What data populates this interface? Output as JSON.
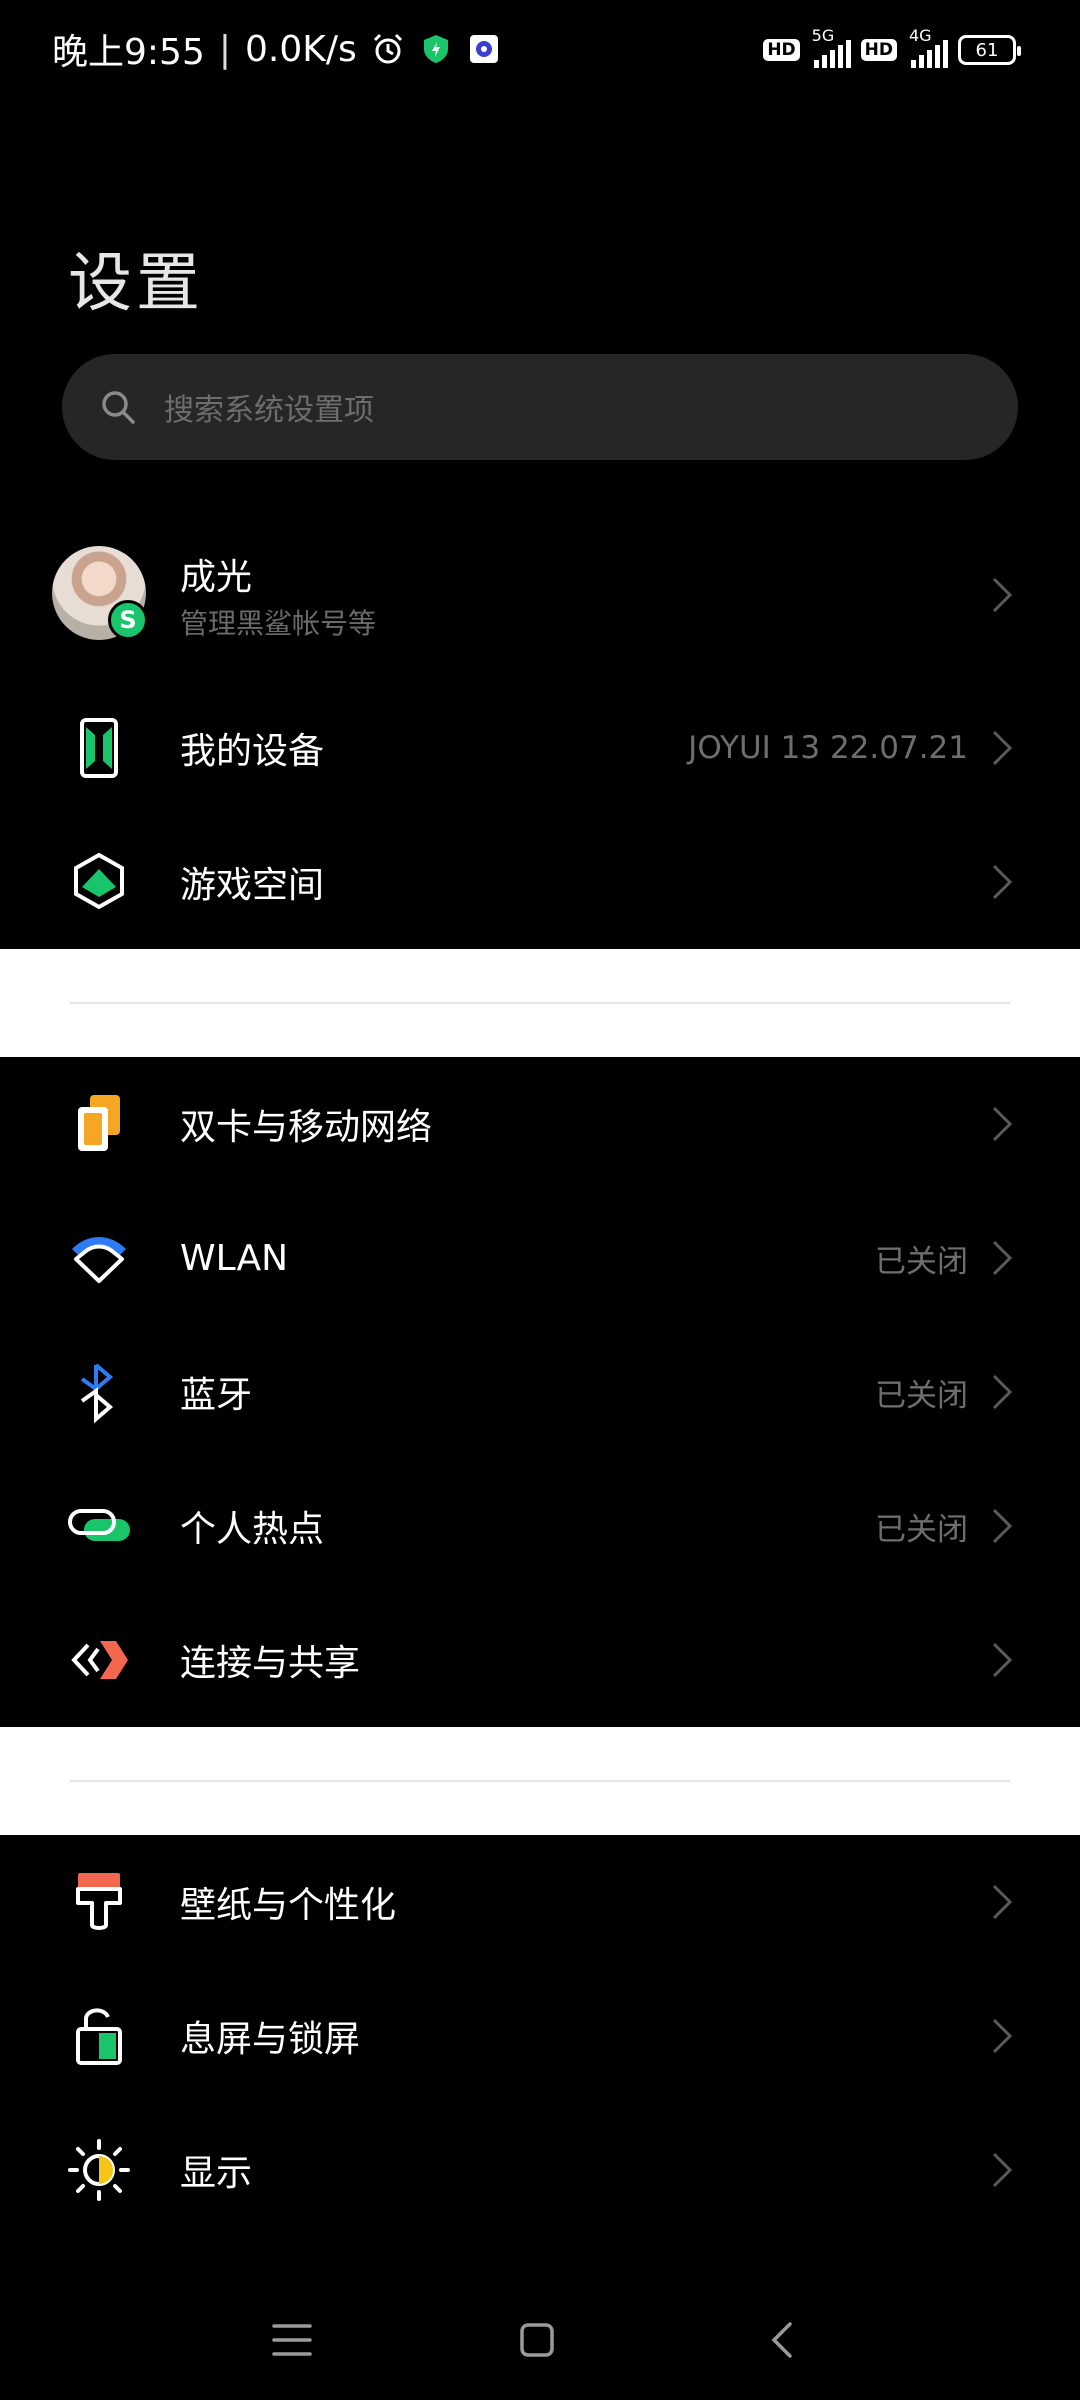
{
  "status_bar": {
    "time": "晚上9:55",
    "separator": "|",
    "speed": "0.0K/s",
    "hd1": "HD",
    "gen1": "5G",
    "hd2": "HD",
    "gen2": "4G",
    "battery": "61"
  },
  "page": {
    "title": "设置",
    "search_placeholder": "搜索系统设置项"
  },
  "account": {
    "name": "成光",
    "subtitle": "管理黑鲨帐号等",
    "badge": "S"
  },
  "items": [
    {
      "label": "我的设备",
      "value": "JOYUI 13 22.07.21",
      "icon": "device-icon"
    },
    {
      "label": "游戏空间",
      "value": "",
      "icon": "game-space-icon"
    },
    {
      "label": "双卡与移动网络",
      "value": "",
      "icon": "sim-card-icon"
    },
    {
      "label": "WLAN",
      "value": "已关闭",
      "icon": "wifi-icon"
    },
    {
      "label": "蓝牙",
      "value": "已关闭",
      "icon": "bluetooth-icon"
    },
    {
      "label": "个人热点",
      "value": "已关闭",
      "icon": "hotspot-icon"
    },
    {
      "label": "连接与共享",
      "value": "",
      "icon": "share-icon"
    },
    {
      "label": "壁纸与个性化",
      "value": "",
      "icon": "wallpaper-icon"
    },
    {
      "label": "息屏与锁屏",
      "value": "",
      "icon": "lock-screen-icon"
    },
    {
      "label": "显示",
      "value": "",
      "icon": "display-icon"
    }
  ],
  "colors": {
    "background": "#000000",
    "accent_green": "#19c46b",
    "accent_orange": "#f5a623",
    "accent_blue": "#2f7bf6",
    "accent_red": "#f2674e"
  }
}
